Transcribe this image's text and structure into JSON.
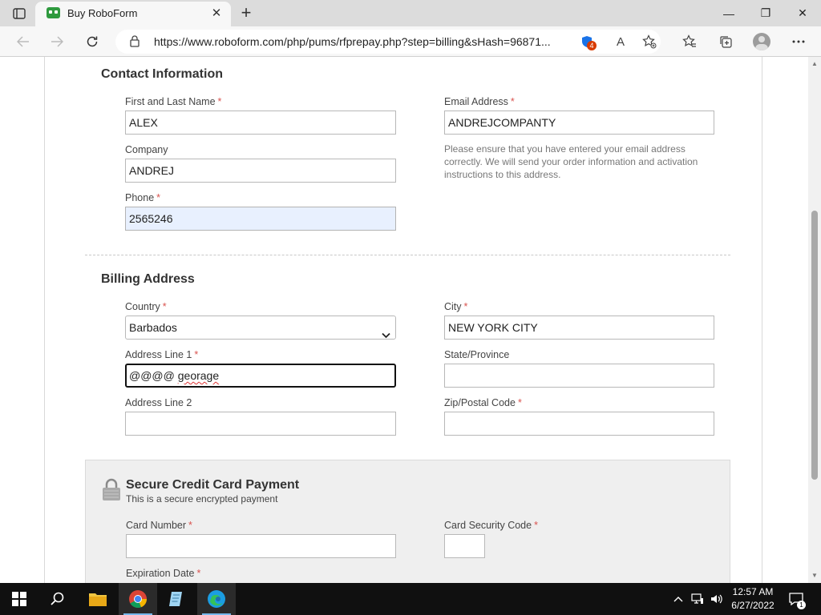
{
  "browser": {
    "tab_title": "Buy RoboForm",
    "tab_close": "✕",
    "new_tab": "+",
    "url": "https://www.roboform.com/php/pums/rfprepay.php?step=billing&sHash=96871...",
    "extension_badge": "4",
    "read_aloud": "A",
    "win_minimize": "—",
    "win_restore": "❐",
    "win_close": "✕"
  },
  "contact": {
    "title": "Contact Information",
    "name_label": "First and Last Name",
    "name_value": "ALEX",
    "company_label": "Company",
    "company_value": "ANDREJ",
    "phone_label": "Phone",
    "phone_value": "2565246",
    "email_label": "Email Address",
    "email_value": "ANDREJCOMPANTY",
    "email_help": "Please ensure that you have entered your email address correctly. We will send your order information and activation instructions to this address.",
    "required_mark": "*"
  },
  "billing": {
    "title": "Billing Address",
    "country_label": "Country",
    "country_value": "Barbados",
    "address1_label": "Address Line 1",
    "address1_prefix": "@@@@ ",
    "address1_word": "georage",
    "address2_label": "Address Line 2",
    "address2_value": "",
    "city_label": "City",
    "city_value": "NEW YORK CITY",
    "state_label": "State/Province",
    "state_value": "",
    "zip_label": "Zip/Postal Code",
    "zip_value": ""
  },
  "payment": {
    "title": "Secure Credit Card Payment",
    "subtitle": "This is a secure encrypted payment",
    "card_number_label": "Card Number",
    "card_number_value": "",
    "security_code_label": "Card Security Code",
    "security_code_value": "",
    "expiration_label": "Expiration Date"
  },
  "taskbar": {
    "time": "12:57 AM",
    "date": "6/27/2022",
    "notifications_count": "1"
  }
}
